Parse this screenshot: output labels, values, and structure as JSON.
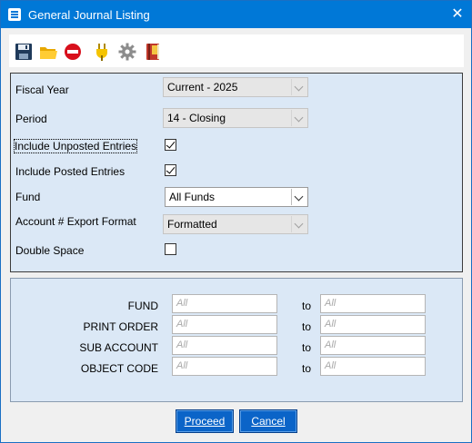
{
  "window": {
    "title": "General Journal Listing",
    "close_glyph": "✕"
  },
  "toolbar": {
    "icons": [
      {
        "name": "save-icon"
      },
      {
        "name": "folder-open-icon"
      },
      {
        "name": "stop-icon"
      },
      {
        "name": "plug-icon"
      },
      {
        "name": "gear-icon"
      },
      {
        "name": "book-icon"
      }
    ]
  },
  "form": {
    "fiscal_year": {
      "label": "Fiscal Year",
      "value": "Current - 2025",
      "enabled": false
    },
    "period": {
      "label": "Period",
      "value": "14 - Closing",
      "enabled": false
    },
    "include_unposted": {
      "label": "Include Unposted Entries",
      "checked": true
    },
    "include_posted": {
      "label": "Include Posted Entries",
      "checked": true
    },
    "fund": {
      "label": "Fund",
      "value": "All Funds",
      "enabled": true
    },
    "account_export_format": {
      "label": "Account # Export Format",
      "value": "Formatted",
      "enabled": false
    },
    "double_space": {
      "label": "Double Space",
      "checked": false
    }
  },
  "ranges": {
    "to_label": "to",
    "rows": [
      {
        "label": "FUND",
        "from_placeholder": "All",
        "to_placeholder": "All"
      },
      {
        "label": "PRINT ORDER",
        "from_placeholder": "All",
        "to_placeholder": "All"
      },
      {
        "label": "SUB ACCOUNT",
        "from_placeholder": "All",
        "to_placeholder": "All"
      },
      {
        "label": "OBJECT CODE",
        "from_placeholder": "All",
        "to_placeholder": "All"
      }
    ]
  },
  "buttons": {
    "proceed": "Proceed",
    "cancel": "Cancel"
  },
  "colors": {
    "titlebar": "#0078d7",
    "panel": "#dbe8f6",
    "button": "#0b64c8"
  }
}
